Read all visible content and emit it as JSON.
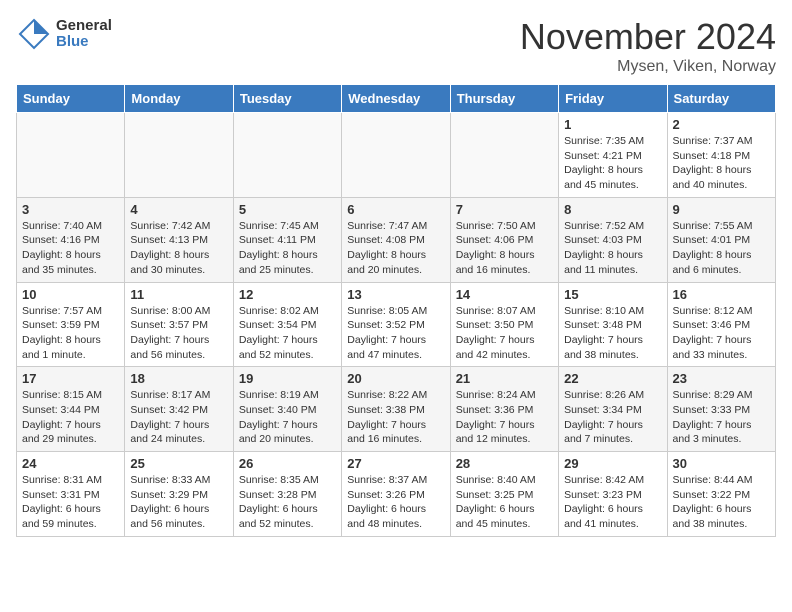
{
  "header": {
    "logo_line1": "General",
    "logo_line2": "Blue",
    "month_title": "November 2024",
    "location": "Mysen, Viken, Norway"
  },
  "weekdays": [
    "Sunday",
    "Monday",
    "Tuesday",
    "Wednesday",
    "Thursday",
    "Friday",
    "Saturday"
  ],
  "weeks": [
    [
      {
        "day": "",
        "text": ""
      },
      {
        "day": "",
        "text": ""
      },
      {
        "day": "",
        "text": ""
      },
      {
        "day": "",
        "text": ""
      },
      {
        "day": "",
        "text": ""
      },
      {
        "day": "1",
        "text": "Sunrise: 7:35 AM\nSunset: 4:21 PM\nDaylight: 8 hours and 45 minutes."
      },
      {
        "day": "2",
        "text": "Sunrise: 7:37 AM\nSunset: 4:18 PM\nDaylight: 8 hours and 40 minutes."
      }
    ],
    [
      {
        "day": "3",
        "text": "Sunrise: 7:40 AM\nSunset: 4:16 PM\nDaylight: 8 hours and 35 minutes."
      },
      {
        "day": "4",
        "text": "Sunrise: 7:42 AM\nSunset: 4:13 PM\nDaylight: 8 hours and 30 minutes."
      },
      {
        "day": "5",
        "text": "Sunrise: 7:45 AM\nSunset: 4:11 PM\nDaylight: 8 hours and 25 minutes."
      },
      {
        "day": "6",
        "text": "Sunrise: 7:47 AM\nSunset: 4:08 PM\nDaylight: 8 hours and 20 minutes."
      },
      {
        "day": "7",
        "text": "Sunrise: 7:50 AM\nSunset: 4:06 PM\nDaylight: 8 hours and 16 minutes."
      },
      {
        "day": "8",
        "text": "Sunrise: 7:52 AM\nSunset: 4:03 PM\nDaylight: 8 hours and 11 minutes."
      },
      {
        "day": "9",
        "text": "Sunrise: 7:55 AM\nSunset: 4:01 PM\nDaylight: 8 hours and 6 minutes."
      }
    ],
    [
      {
        "day": "10",
        "text": "Sunrise: 7:57 AM\nSunset: 3:59 PM\nDaylight: 8 hours and 1 minute."
      },
      {
        "day": "11",
        "text": "Sunrise: 8:00 AM\nSunset: 3:57 PM\nDaylight: 7 hours and 56 minutes."
      },
      {
        "day": "12",
        "text": "Sunrise: 8:02 AM\nSunset: 3:54 PM\nDaylight: 7 hours and 52 minutes."
      },
      {
        "day": "13",
        "text": "Sunrise: 8:05 AM\nSunset: 3:52 PM\nDaylight: 7 hours and 47 minutes."
      },
      {
        "day": "14",
        "text": "Sunrise: 8:07 AM\nSunset: 3:50 PM\nDaylight: 7 hours and 42 minutes."
      },
      {
        "day": "15",
        "text": "Sunrise: 8:10 AM\nSunset: 3:48 PM\nDaylight: 7 hours and 38 minutes."
      },
      {
        "day": "16",
        "text": "Sunrise: 8:12 AM\nSunset: 3:46 PM\nDaylight: 7 hours and 33 minutes."
      }
    ],
    [
      {
        "day": "17",
        "text": "Sunrise: 8:15 AM\nSunset: 3:44 PM\nDaylight: 7 hours and 29 minutes."
      },
      {
        "day": "18",
        "text": "Sunrise: 8:17 AM\nSunset: 3:42 PM\nDaylight: 7 hours and 24 minutes."
      },
      {
        "day": "19",
        "text": "Sunrise: 8:19 AM\nSunset: 3:40 PM\nDaylight: 7 hours and 20 minutes."
      },
      {
        "day": "20",
        "text": "Sunrise: 8:22 AM\nSunset: 3:38 PM\nDaylight: 7 hours and 16 minutes."
      },
      {
        "day": "21",
        "text": "Sunrise: 8:24 AM\nSunset: 3:36 PM\nDaylight: 7 hours and 12 minutes."
      },
      {
        "day": "22",
        "text": "Sunrise: 8:26 AM\nSunset: 3:34 PM\nDaylight: 7 hours and 7 minutes."
      },
      {
        "day": "23",
        "text": "Sunrise: 8:29 AM\nSunset: 3:33 PM\nDaylight: 7 hours and 3 minutes."
      }
    ],
    [
      {
        "day": "24",
        "text": "Sunrise: 8:31 AM\nSunset: 3:31 PM\nDaylight: 6 hours and 59 minutes."
      },
      {
        "day": "25",
        "text": "Sunrise: 8:33 AM\nSunset: 3:29 PM\nDaylight: 6 hours and 56 minutes."
      },
      {
        "day": "26",
        "text": "Sunrise: 8:35 AM\nSunset: 3:28 PM\nDaylight: 6 hours and 52 minutes."
      },
      {
        "day": "27",
        "text": "Sunrise: 8:37 AM\nSunset: 3:26 PM\nDaylight: 6 hours and 48 minutes."
      },
      {
        "day": "28",
        "text": "Sunrise: 8:40 AM\nSunset: 3:25 PM\nDaylight: 6 hours and 45 minutes."
      },
      {
        "day": "29",
        "text": "Sunrise: 8:42 AM\nSunset: 3:23 PM\nDaylight: 6 hours and 41 minutes."
      },
      {
        "day": "30",
        "text": "Sunrise: 8:44 AM\nSunset: 3:22 PM\nDaylight: 6 hours and 38 minutes."
      }
    ]
  ]
}
